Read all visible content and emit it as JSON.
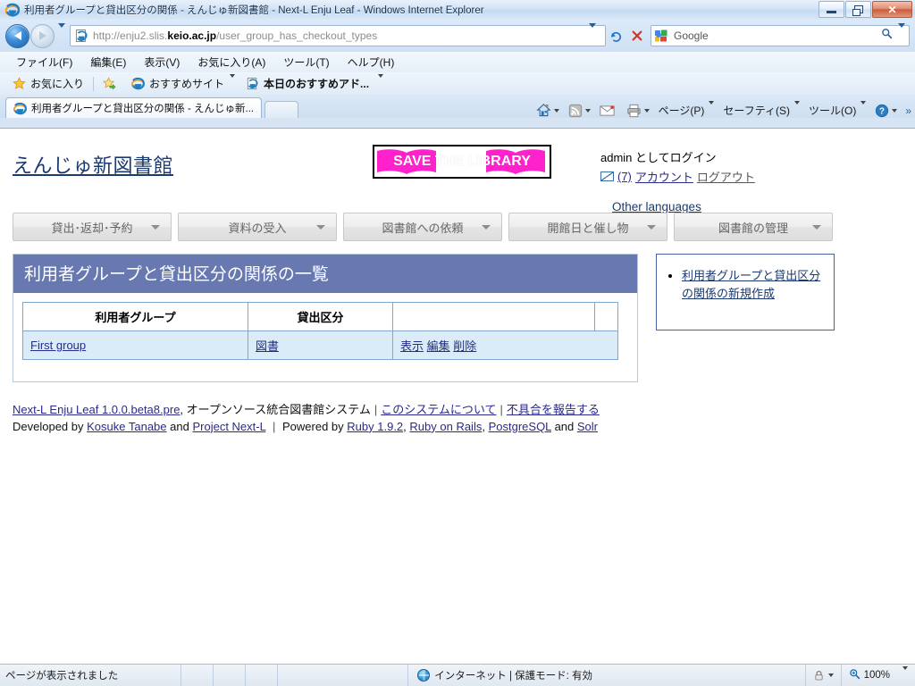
{
  "browser": {
    "window_title": "利用者グループと貸出区分の関係 - えんじゅ新図書館 - Next-L Enju Leaf - Windows Internet Explorer",
    "window_controls": {
      "minimize": "minimize-button",
      "restore": "restore-button",
      "close": "✕"
    },
    "address": {
      "url_prefix": "http://enju2.slis.",
      "url_domain": "keio.ac.jp",
      "url_suffix": "/user_group_has_checkout_types",
      "refresh_glyph": "↯",
      "stop_glyph": "✕"
    },
    "search": {
      "engine_label": "Google"
    },
    "menu": [
      "ファイル(F)",
      "編集(E)",
      "表示(V)",
      "お気に入り(A)",
      "ツール(T)",
      "ヘルプ(H)"
    ],
    "favorites_bar": {
      "favorites_label": "お気に入り",
      "items": [
        {
          "label": "おすすめサイト",
          "has_caret": true
        },
        {
          "label": "本日のおすすめアド...",
          "has_caret": true
        }
      ]
    },
    "tabs": [
      {
        "label": "利用者グループと貸出区分の関係 - えんじゅ新...",
        "active": true
      }
    ],
    "command_bar": [
      {
        "label": "ページ(P)"
      },
      {
        "label": "セーフティ(S)"
      },
      {
        "label": "ツール(O)"
      }
    ],
    "overflow_chevron": "»"
  },
  "page": {
    "site_title": "えんじゅ新図書館",
    "logo": {
      "text": "SAVE THE LIBRARY",
      "color": "#ff22cc"
    },
    "account": {
      "logged_in_as": "admin としてログイン",
      "message_count": "(7)",
      "account_link": "アカウント",
      "logout_link": "ログアウト",
      "other_languages": "Other languages"
    },
    "nav_menu": [
      "貸出･返却･予約",
      "資料の受入",
      "図書館への依頼",
      "開館日と催し物",
      "図書館の管理"
    ],
    "heading": "利用者グループと貸出区分の関係の一覧",
    "table": {
      "columns": [
        "利用者グループ",
        "貸出区分",
        "",
        ""
      ],
      "rows": [
        {
          "user_group": "First group",
          "checkout_type": "図書",
          "actions": [
            "表示",
            "編集",
            "削除"
          ]
        }
      ]
    },
    "sidebar": {
      "links": [
        "利用者グループと貸出区分の関係の新規作成"
      ]
    },
    "footer": {
      "product": "Next-L Enju Leaf 1.0.0.beta8.pre",
      "product_desc": ", オープンソース統合図書館システム",
      "about_link": "このシステムについて",
      "bug_link": "不具合を報告する",
      "developed_by": "Developed by",
      "dev1": "Kosuke Tanabe",
      "and1": "and",
      "dev2": "Project Next-L",
      "powered_by": "Powered by",
      "tech": [
        "Ruby 1.9.2",
        "Ruby on Rails",
        "PostgreSQL",
        "Solr"
      ],
      "and2": "and",
      "sep": "|"
    }
  },
  "statusbar": {
    "message": "ページが表示されました",
    "zone": "インターネット | 保護モード: 有効",
    "zoom": "100%"
  }
}
